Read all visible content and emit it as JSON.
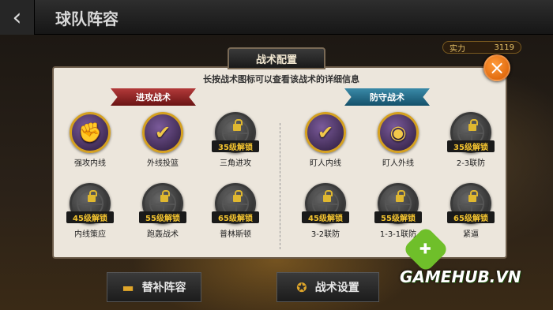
{
  "header": {
    "back_glyph": "‹",
    "title": "球队阵容"
  },
  "power": {
    "label": "实力",
    "value": "3119"
  },
  "dialog": {
    "title": "战术配置",
    "hint": "长按战术图标可以查看该战术的详细信息",
    "close_glyph": "×",
    "offense_banner": "进攻战术",
    "defense_banner": "防守战术",
    "offense": [
      {
        "label": "强攻内线",
        "tag": "",
        "glyph": "✊"
      },
      {
        "label": "外线投篮",
        "tag": "",
        "glyph": "✔"
      },
      {
        "label": "三角进攻",
        "tag": "35级解锁",
        "glyph": ""
      },
      {
        "label": "内线策应",
        "tag": "45级解锁",
        "glyph": ""
      },
      {
        "label": "跑轰战术",
        "tag": "55级解锁",
        "glyph": ""
      },
      {
        "label": "普林斯顿",
        "tag": "65级解锁",
        "glyph": ""
      }
    ],
    "defense": [
      {
        "label": "盯人内线",
        "tag": "",
        "glyph": "✔"
      },
      {
        "label": "盯人外线",
        "tag": "",
        "glyph": "◉"
      },
      {
        "label": "2-3联防",
        "tag": "35级解锁",
        "glyph": ""
      },
      {
        "label": "3-2联防",
        "tag": "45级解锁",
        "glyph": ""
      },
      {
        "label": "1-3-1联防",
        "tag": "55级解锁",
        "glyph": ""
      },
      {
        "label": "紧逼",
        "tag": "65级解锁",
        "glyph": ""
      }
    ]
  },
  "bottom": {
    "subs_label": "替补阵容",
    "tactics_label": "战术设置"
  },
  "watermark": {
    "text": "GAMEHUB.VN",
    "glyph": "✚"
  }
}
